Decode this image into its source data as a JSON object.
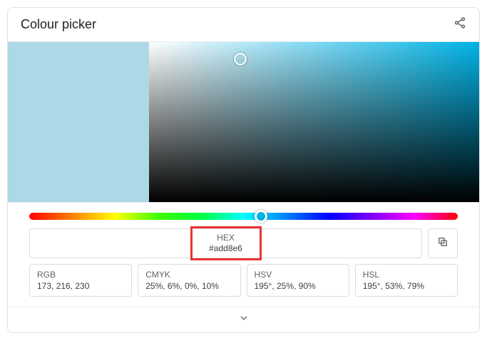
{
  "header": {
    "title": "Colour picker"
  },
  "hex": {
    "label": "HEX",
    "value": "#add8e6"
  },
  "formats": {
    "rgb": {
      "label": "RGB",
      "value": "173, 216, 230"
    },
    "cmyk": {
      "label": "CMYK",
      "value": "25%, 6%, 0%, 10%"
    },
    "hsv": {
      "label": "HSV",
      "value": "195°, 25%, 90%"
    },
    "hsl": {
      "label": "HSL",
      "value": "195°, 53%, 79%"
    }
  },
  "color": {
    "swatch": "#add8e6"
  }
}
